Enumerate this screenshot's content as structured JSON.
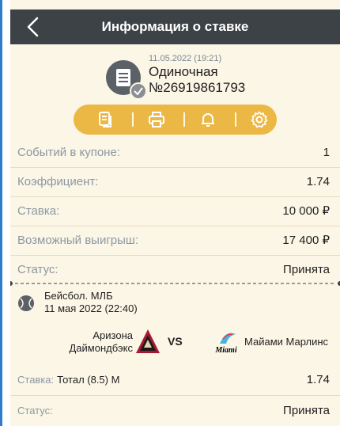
{
  "header": {
    "title": "Информация о ставке"
  },
  "ticket": {
    "datetime": "11.05.2022 (19:21)",
    "type": "Одиночная",
    "number": "№26919861793"
  },
  "actions": [
    {
      "icon": "document-icon"
    },
    {
      "icon": "printer-icon"
    },
    {
      "icon": "bell-icon"
    },
    {
      "icon": "gear-icon"
    }
  ],
  "summary": [
    {
      "label": "Событий в купоне:",
      "value": "1"
    },
    {
      "label": "Коэффициент:",
      "value": "1.74"
    },
    {
      "label": "Ставка:",
      "value": "10 000 ₽"
    },
    {
      "label": "Возможный выигрыш:",
      "value": "17 400 ₽"
    },
    {
      "label": "Статус:",
      "value": "Принята"
    }
  ],
  "event": {
    "league": "Бейсбол. МЛБ",
    "date": "11 мая 2022 (22:40)",
    "team1": "Аризона Даймондбэкс",
    "team1_line1": "Аризона",
    "team1_line2": "Даймондбэкс",
    "vs": "VS",
    "team2": "Майами Марлинс",
    "team2_logo_text": "Miami"
  },
  "bet": {
    "stake_label": "Ставка:",
    "stake_value": "Тотал (8.5) М",
    "coefficient": "1.74",
    "status_label": "Статус:",
    "status_value": "Принята"
  },
  "colors": {
    "header_bg": "#3d4247",
    "accent": "#ecb845",
    "background": "#fbf6e6",
    "label_gray": "#8c98a3"
  }
}
